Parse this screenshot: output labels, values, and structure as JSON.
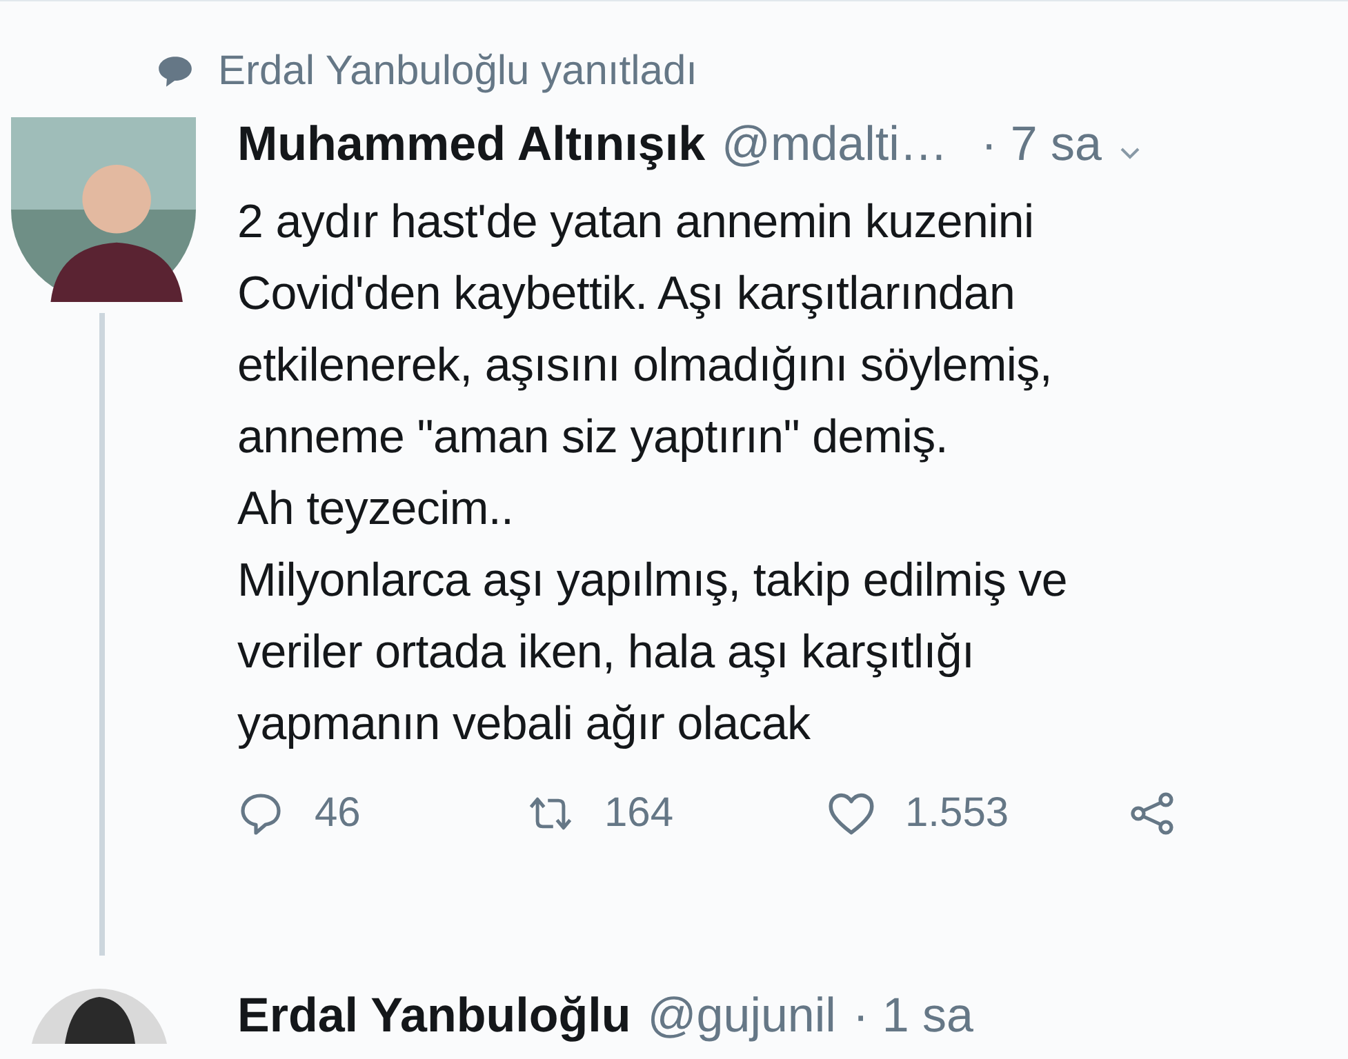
{
  "reply_context": {
    "text": "Erdal Yanbuloğlu yanıtladı"
  },
  "tweet": {
    "author": "Muhammed Altınışık",
    "handle": "@mdalti…",
    "time": "· 7 sa",
    "text": "2 aydır hast'de yatan annemin kuzenini\nCovid'den kaybettik. Aşı karşıtlarından\netkilenerek, aşısını olmadığını söylemiş,\nanneme \"aman siz yaptırın\" demiş.\nAh teyzecim..\nMilyonlarca aşı yapılmış, takip edilmiş ve\nveriler ortada iken, hala aşı karşıtlığı\nyapmanın vebali ağır olacak",
    "actions": [
      {
        "kind": "reply",
        "count": "46"
      },
      {
        "kind": "retweet",
        "count": "164"
      },
      {
        "kind": "like",
        "count": "1.553"
      },
      {
        "kind": "share"
      }
    ]
  },
  "next_tweet": {
    "author": "Erdal Yanbuloğlu",
    "handle": "@gujunil",
    "time": "· 1 sa"
  }
}
